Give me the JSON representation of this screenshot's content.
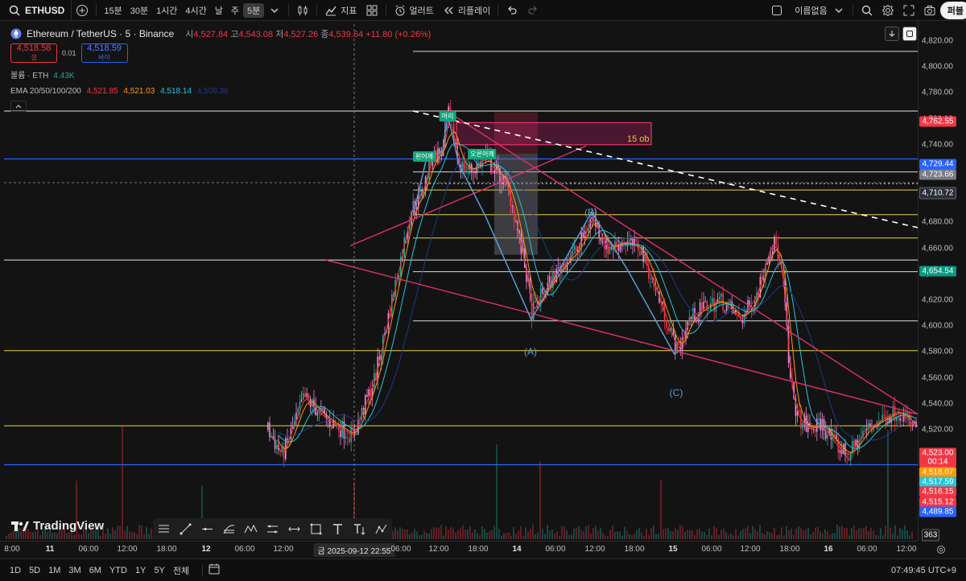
{
  "toolbar": {
    "symbol": "ETHUSD",
    "intervals": [
      "15분",
      "30분",
      "1시간",
      "4시간",
      "날",
      "주",
      "5분"
    ],
    "active_interval": "5분",
    "indicators_label": "지표",
    "alert_label": "얼러트",
    "replay_label": "리플레이",
    "layout_name": "이름없음",
    "publish_label": "퍼블"
  },
  "legend": {
    "title": "Ethereum / TetherUS · 5 · Binance",
    "open_label": "시",
    "open": "4,527.84",
    "high_label": "고",
    "high": "4,543.08",
    "low_label": "저",
    "low": "4,527.26",
    "close_label": "종",
    "close": "4,539.64",
    "change": "+11.80 (+0.26%)",
    "sell_price": "4,518.58",
    "sell_label": "셀",
    "spread": "0.01",
    "buy_price": "4,518.59",
    "buy_label": "바이",
    "volume_label": "볼륨 · ETH",
    "volume": "4.43K",
    "ema_label": "EMA 20/50/100/200",
    "ema_values": [
      "4,521.85",
      "4,521.03",
      "4,518.14",
      "4,509.36"
    ],
    "ema_colors": [
      "#f23645",
      "#ff9800",
      "#26c6da",
      "#1e3a8a"
    ]
  },
  "chart_data": {
    "type": "candlestick",
    "symbol": "ETHUSDT",
    "interval": "5",
    "ylim": [
      4475,
      4830
    ],
    "y_ticks": [
      4820,
      4800,
      4780,
      4760,
      4740,
      4720,
      4700,
      4680,
      4660,
      4640,
      4620,
      4600,
      4580,
      4560,
      4540,
      4520
    ],
    "x_ticks": [
      "8:00",
      "11",
      "06:00",
      "12:00",
      "18:00",
      "12",
      "06:00",
      "12:00",
      "금 2025-09-12  22:55",
      "06:00",
      "12:00",
      "18:00",
      "14",
      "06:00",
      "12:00",
      "18:00",
      "15",
      "06:00",
      "12:00",
      "18:00",
      "16",
      "06:00",
      "12:00"
    ],
    "horizontal_levels": [
      4812,
      4766,
      4729,
      4719,
      4710,
      4705,
      4686,
      4668,
      4651,
      4642,
      4604,
      4581,
      4523,
      4493
    ],
    "price_labels": [
      {
        "value": "4,762.55",
        "color": "#f23645"
      },
      {
        "value": "4,729.44",
        "color": "#2962ff"
      },
      {
        "value": "4,723.66",
        "color": "#787b86"
      },
      {
        "value": "4,710.72",
        "color": "#2a2e39"
      },
      {
        "value": "4,654.54",
        "color": "#089981"
      },
      {
        "value": "4,523.00",
        "color": "#f23645"
      },
      {
        "value": "00:14",
        "color": "#f23645"
      },
      {
        "value": "4,518.07",
        "color": "#ff9800"
      },
      {
        "value": "4,517.59",
        "color": "#26c6da"
      },
      {
        "value": "4,516.15",
        "color": "#f23645"
      },
      {
        "value": "4,515.12",
        "color": "#f23645"
      },
      {
        "value": "4,489.85",
        "color": "#2962ff"
      },
      {
        "value": "363",
        "color": "#1b1b1b"
      }
    ],
    "wave_labels": [
      "(A)",
      "(B)",
      "(C)"
    ],
    "tags": [
      "왼어깨",
      "머리",
      "오른어깨"
    ],
    "order_block_label": "15  ob"
  },
  "bottombar": {
    "ranges": [
      "1D",
      "5D",
      "1M",
      "3M",
      "6M",
      "YTD",
      "1Y",
      "5Y",
      "전체"
    ],
    "clock": "07:49:45 UTC+9"
  },
  "branding": {
    "logo": "TradingView"
  }
}
